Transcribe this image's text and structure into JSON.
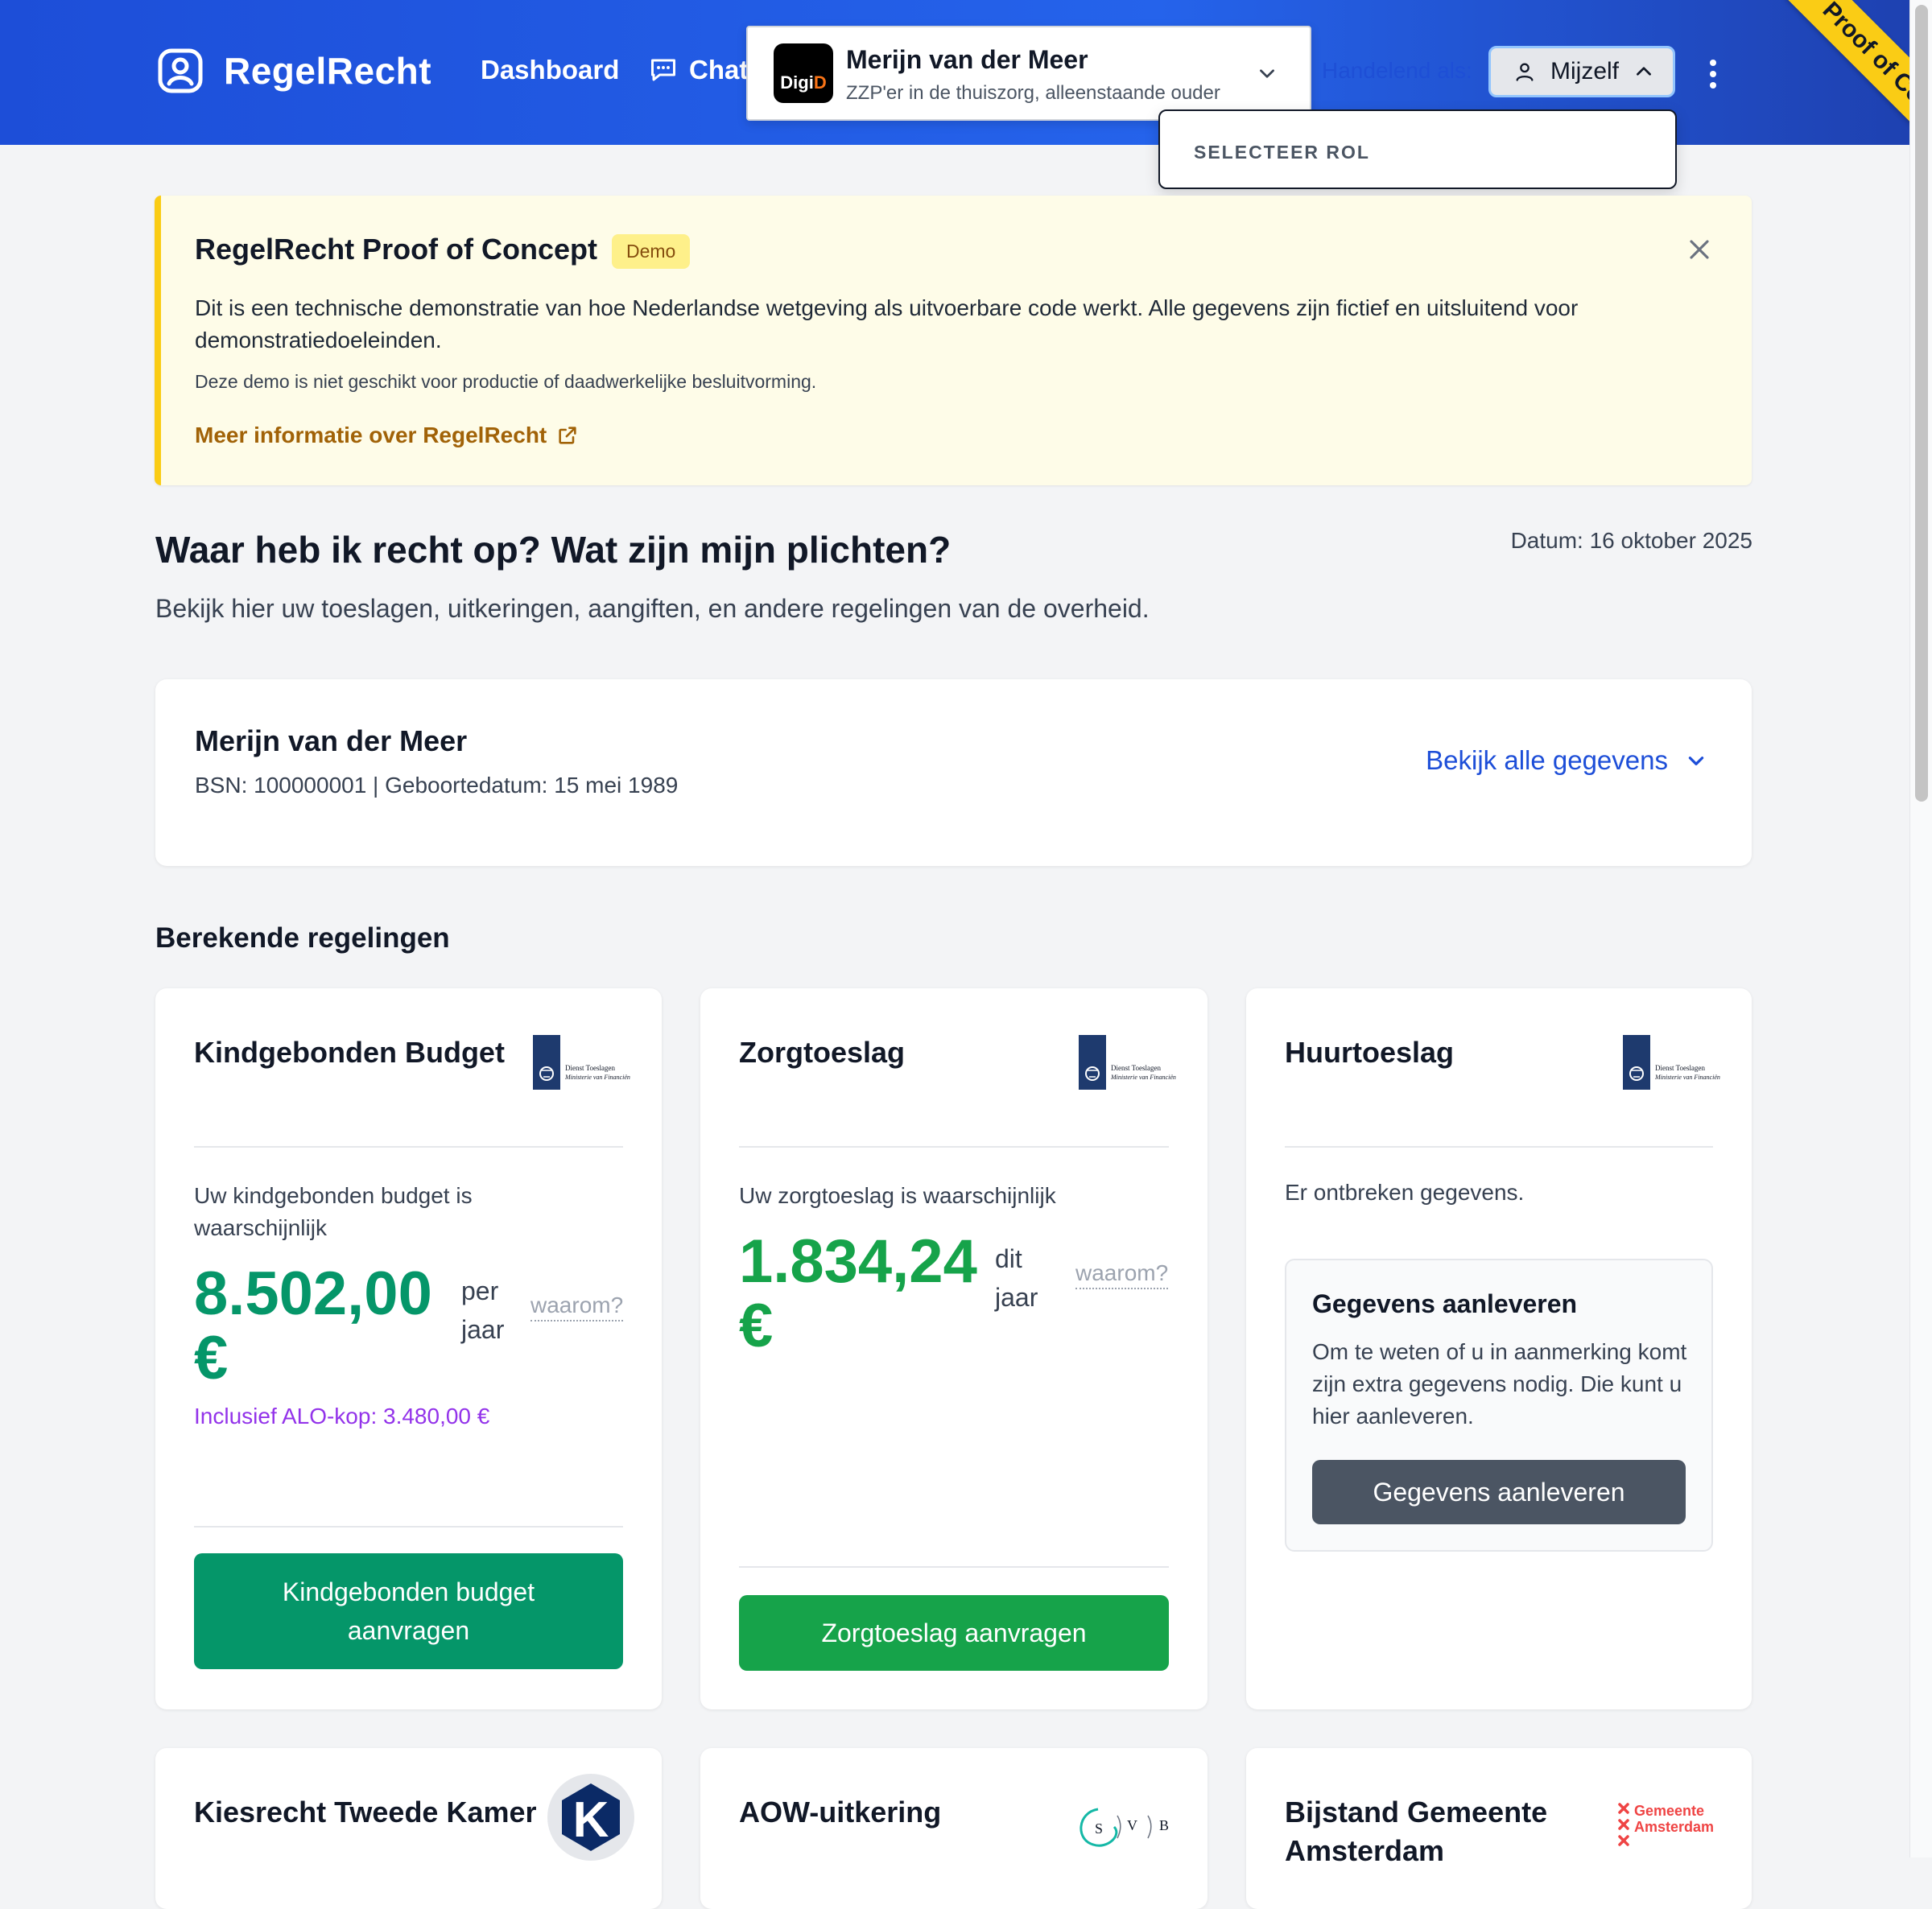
{
  "app": {
    "name": "RegelRecht"
  },
  "nav": {
    "dashboard": "Dashboard",
    "chat": "Chat"
  },
  "digid": {
    "logo_text_1": "Digi",
    "logo_text_2": "D",
    "name": "Merijn van der Meer",
    "subtitle": "ZZP'er in de thuiszorg, alleenstaande ouder"
  },
  "acting": {
    "label": "Handelend als:",
    "role_button": "Mijzelf",
    "dropdown_header": "SELECTEER ROL"
  },
  "ribbon": "Proof of Concept",
  "banner": {
    "title": "RegelRecht Proof of Concept",
    "badge": "Demo",
    "text": "Dit is een technische demonstratie van hoe Nederlandse wetgeving als uitvoerbare code werkt. Alle gegevens zijn fictief en uitsluitend voor demonstratiedoeleinden.",
    "small": "Deze demo is niet geschikt voor productie of daadwerkelijke besluitvorming.",
    "link": "Meer informatie over RegelRecht"
  },
  "page": {
    "title": "Waar heb ik recht op? Wat zijn mijn plichten?",
    "date": "Datum: 16 oktober 2025",
    "subtitle": "Bekijk hier uw toeslagen, uitkeringen, aangiften, en andere regelingen van de overheid."
  },
  "person": {
    "name": "Merijn van der Meer",
    "meta": "BSN: 100000001 | Geboortedatum: 15 mei 1989",
    "details_link": "Bekijk alle gegevens"
  },
  "section": {
    "title": "Berekende regelingen"
  },
  "logos": {
    "toeslagen_line1": "Dienst Toeslagen",
    "toeslagen_line2": "Ministerie van Financiën",
    "kiesraad_letter": "K",
    "svb_letters": [
      "S",
      "V",
      "B"
    ],
    "amsterdam_line1": "Gemeente",
    "amsterdam_line2": "Amsterdam"
  },
  "cards": {
    "kgb": {
      "title": "Kindgebonden Budget",
      "label": "Uw kindgebonden budget is waarschijnlijk",
      "amount": "8.502,00",
      "currency": "€",
      "unit_1": "per",
      "unit_2": "jaar",
      "why": "waarom?",
      "alo": "Inclusief ALO-kop: 3.480,00 €",
      "button_1": "Kindgebonden budget",
      "button_2": "aanvragen"
    },
    "zorg": {
      "title": "Zorgtoeslag",
      "label": "Uw zorgtoeslag is waarschijnlijk",
      "amount": "1.834,24",
      "currency": "€",
      "unit_1": "dit",
      "unit_2": "jaar",
      "why": "waarom?",
      "button": "Zorgtoeslag aanvragen"
    },
    "huur": {
      "title": "Huurtoeslag",
      "missing": "Er ontbreken gegevens.",
      "box_title": "Gegevens aanleveren",
      "box_text": "Om te weten of u in aanmerking komt zijn extra gegevens nodig. Die kunt u hier aanleveren.",
      "box_button": "Gegevens aanleveren"
    },
    "kiesrecht": {
      "title": "Kiesrecht Tweede Kamer"
    },
    "aow": {
      "title": "AOW-uitkering"
    },
    "bijstand": {
      "title": "Bijstand Gemeente Amsterdam"
    }
  },
  "colors": {
    "header_blue": "#2563eb",
    "amount_green": "#059669",
    "button_green": "#16a34a",
    "alo_purple": "#9333ea",
    "banner_yellow": "#fefce8"
  }
}
